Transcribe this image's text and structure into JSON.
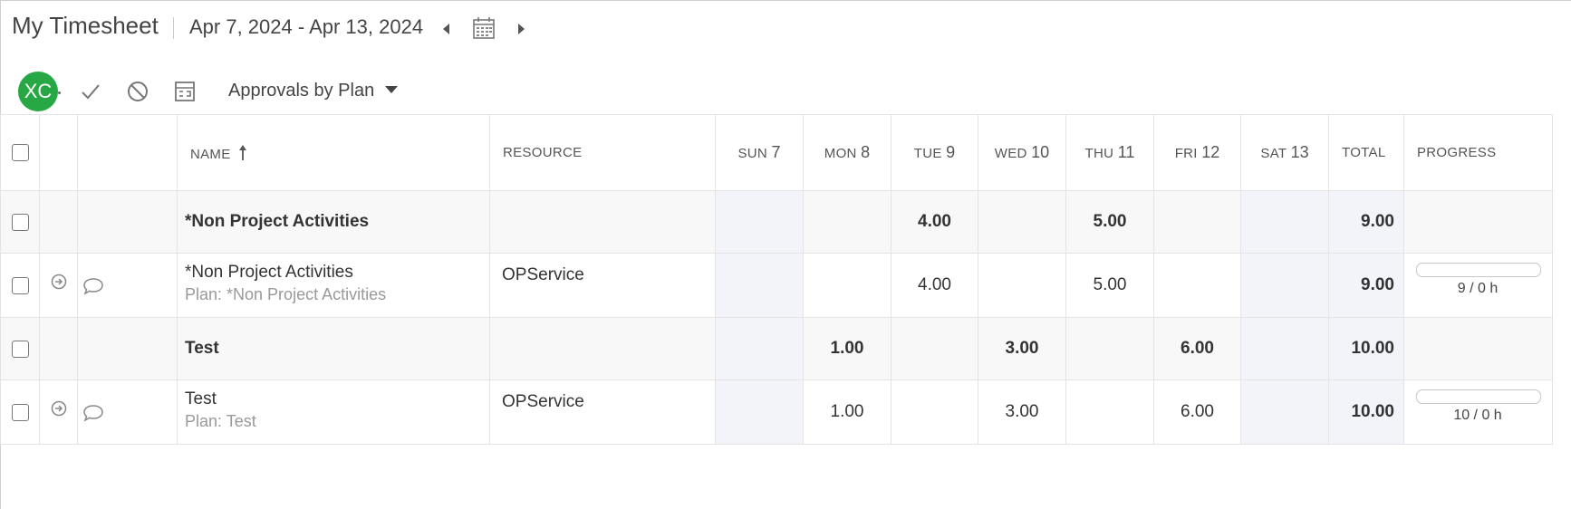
{
  "header": {
    "title": "My Timesheet",
    "date_range": "Apr 7, 2024 - Apr 13, 2024"
  },
  "toolbar": {
    "avatar_initials": "XC",
    "avatar_color": "#28a745",
    "approvals_label": "Approvals by Plan",
    "icons": [
      "check-icon",
      "block-icon",
      "report-icon"
    ]
  },
  "table": {
    "columns": {
      "name": "NAME",
      "resource": "RESOURCE",
      "days": [
        {
          "dow": "SUN",
          "num": "7"
        },
        {
          "dow": "MON",
          "num": "8"
        },
        {
          "dow": "TUE",
          "num": "9"
        },
        {
          "dow": "WED",
          "num": "10"
        },
        {
          "dow": "THU",
          "num": "11"
        },
        {
          "dow": "FRI",
          "num": "12"
        },
        {
          "dow": "SAT",
          "num": "13"
        }
      ],
      "total": "TOTAL",
      "progress": "PROGRESS"
    },
    "rows": [
      {
        "name": "*Non Project Activities",
        "days": [
          "",
          "",
          "4.00",
          "",
          "5.00",
          "",
          ""
        ],
        "total": "9.00"
      },
      {
        "name": "*Non Project Activities",
        "plan": "Plan: *Non Project Activities",
        "resource": "OPService",
        "days": [
          "",
          "",
          "4.00",
          "",
          "5.00",
          "",
          ""
        ],
        "total": "9.00",
        "progress_text": "9 / 0 h",
        "progress_fraction": 0
      },
      {
        "name": "Test",
        "days": [
          "",
          "1.00",
          "",
          "3.00",
          "",
          "6.00",
          ""
        ],
        "total": "10.00"
      },
      {
        "name": "Test",
        "plan": "Plan: Test",
        "resource": "OPService",
        "days": [
          "",
          "1.00",
          "",
          "3.00",
          "",
          "6.00",
          ""
        ],
        "total": "10.00",
        "progress_text": "10 / 0 h",
        "progress_fraction": 0
      }
    ]
  }
}
